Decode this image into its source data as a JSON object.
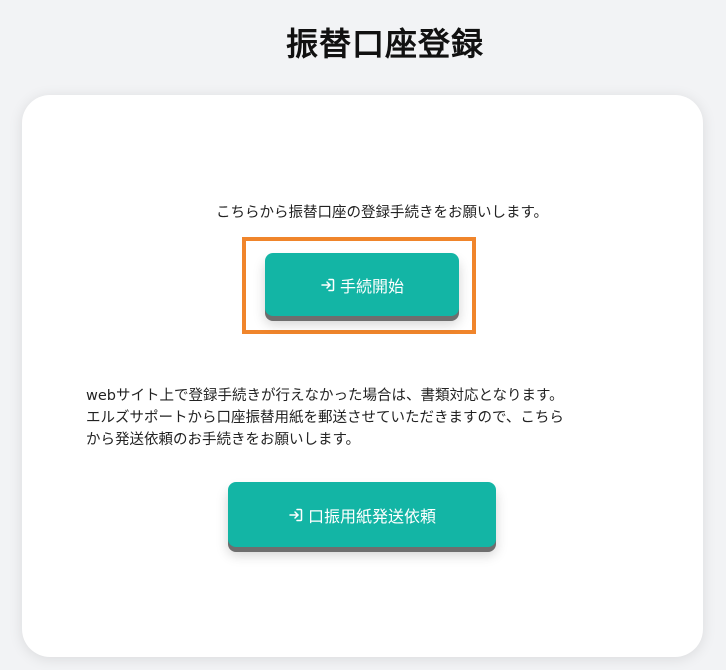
{
  "page": {
    "title": "振替口座登録"
  },
  "card": {
    "intro_text": "こちらから振替口座の登録手続きをお願いします。",
    "start_button_label": "手続開始",
    "note_lines": [
      "webサイト上で登録手続きが行えなかった場合は、書類対応となります。",
      "エルズサポートから口座振替用紙を郵送させていただきますので、こちら",
      "から発送依頼のお手続きをお願いします。"
    ],
    "postal_button_label": "口振用紙発送依頼"
  },
  "icons": {
    "start_button_icon": "login-icon",
    "postal_button_icon": "login-icon"
  },
  "colors": {
    "button": "#13b5a5",
    "highlight": "#f0852b",
    "background": "#f2f3f5"
  }
}
